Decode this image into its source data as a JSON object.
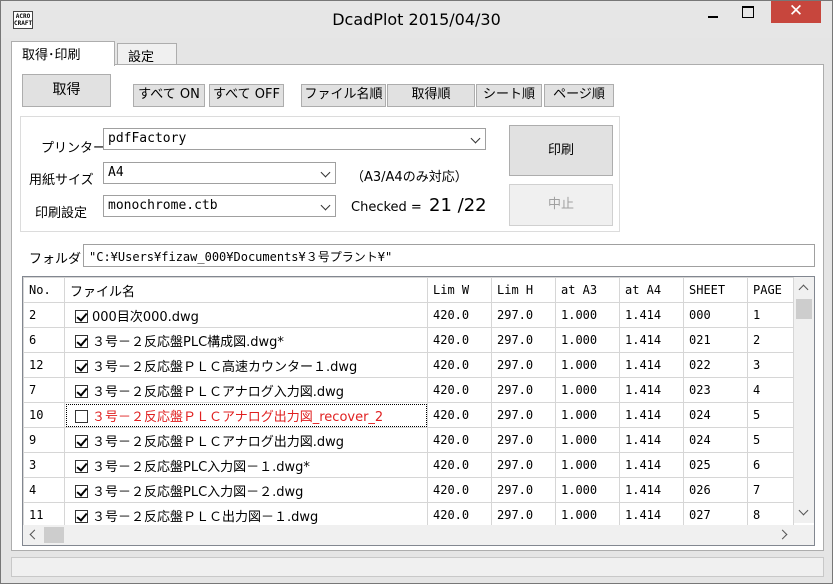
{
  "window": {
    "title": "DcadPlot 2015/04/30",
    "icon_text": "ACRO CRAFT",
    "close_glyph": "✕"
  },
  "tabs": [
    {
      "label": "取得･印刷",
      "active": true
    },
    {
      "label": "設定",
      "active": false
    }
  ],
  "toolbar": {
    "fetch_label": "取得",
    "all_on_label": "すべて ON",
    "all_off_label": "すべて OFF",
    "sort_filename_label": "ファイル名順",
    "sort_fetch_label": "取得順",
    "sort_sheet_label": "シート順",
    "sort_page_label": "ページ順"
  },
  "print": {
    "printer_label": "プリンター",
    "printer_value": "pdfFactory",
    "paper_label": "用紙サイズ",
    "paper_value": "A4",
    "paper_note": "（A3/A4のみ対応）",
    "setting_label": "印刷設定",
    "setting_value": "monochrome.ctb",
    "checked_label": "Checked =",
    "checked_count": "21 /22",
    "print_button": "印刷",
    "stop_button": "中止"
  },
  "folder": {
    "label": "フォルダ",
    "value": "\"C:¥Users¥fizaw_000¥Documents¥３号プラント¥\""
  },
  "grid": {
    "columns": [
      "No.",
      "ファイル名",
      "Lim W",
      "Lim H",
      "at A3",
      "at A4",
      "SHEET",
      "PAGE"
    ],
    "rows": [
      {
        "no": "2",
        "checked": true,
        "name": "000目次000.dwg",
        "limw": "420.0",
        "limh": "297.0",
        "a3": "1.000",
        "a4": "1.414",
        "sheet": "000",
        "page": "1"
      },
      {
        "no": "6",
        "checked": true,
        "name": "３号－２反応盤PLC構成図.dwg*",
        "limw": "420.0",
        "limh": "297.0",
        "a3": "1.000",
        "a4": "1.414",
        "sheet": "021",
        "page": "2"
      },
      {
        "no": "12",
        "checked": true,
        "name": "３号－２反応盤ＰＬＣ高速カウンター１.dwg",
        "limw": "420.0",
        "limh": "297.0",
        "a3": "1.000",
        "a4": "1.414",
        "sheet": "022",
        "page": "3"
      },
      {
        "no": "7",
        "checked": true,
        "name": "３号－２反応盤ＰＬＣアナログ入力図.dwg",
        "limw": "420.0",
        "limh": "297.0",
        "a3": "1.000",
        "a4": "1.414",
        "sheet": "023",
        "page": "4"
      },
      {
        "no": "10",
        "checked": false,
        "selected": true,
        "name": "３号－２反応盤ＰＬＣアナログ出力図_recover_2",
        "limw": "420.0",
        "limh": "297.0",
        "a3": "1.000",
        "a4": "1.414",
        "sheet": "024",
        "page": "5"
      },
      {
        "no": "9",
        "checked": true,
        "name": "３号－２反応盤ＰＬＣアナログ出力図.dwg",
        "limw": "420.0",
        "limh": "297.0",
        "a3": "1.000",
        "a4": "1.414",
        "sheet": "024",
        "page": "5"
      },
      {
        "no": "3",
        "checked": true,
        "name": "３号－２反応盤PLC入力図－１.dwg*",
        "limw": "420.0",
        "limh": "297.0",
        "a3": "1.000",
        "a4": "1.414",
        "sheet": "025",
        "page": "6"
      },
      {
        "no": "4",
        "checked": true,
        "name": "３号－２反応盤PLC入力図－２.dwg",
        "limw": "420.0",
        "limh": "297.0",
        "a3": "1.000",
        "a4": "1.414",
        "sheet": "026",
        "page": "7"
      },
      {
        "no": "11",
        "checked": true,
        "name": "３号－２反応盤ＰＬＣ出力図－１.dwg",
        "limw": "420.0",
        "limh": "297.0",
        "a3": "1.000",
        "a4": "1.414",
        "sheet": "027",
        "page": "8"
      }
    ]
  }
}
